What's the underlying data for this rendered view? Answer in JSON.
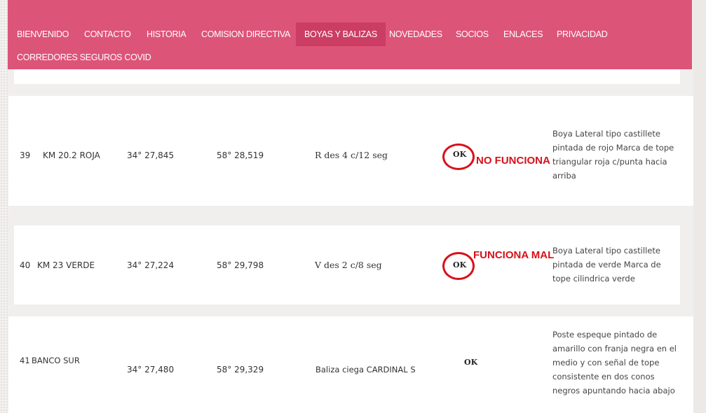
{
  "nav": {
    "items": [
      {
        "label": "BIENVENIDO"
      },
      {
        "label": "CONTACTO"
      },
      {
        "label": "HISTORIA"
      },
      {
        "label": "COMISION DIRECTIVA"
      },
      {
        "label": "BOYAS Y BALIZAS",
        "active": true
      },
      {
        "label": "NOVEDADES"
      },
      {
        "label": "SOCIOS"
      },
      {
        "label": "ENLACES"
      },
      {
        "label": "PRIVACIDAD"
      },
      {
        "label": "CORREDORES SEGUROS COVID"
      }
    ]
  },
  "rows": [
    {
      "num": "39",
      "name": "KM 20.2 ROJA",
      "lat": "34° 27,845",
      "lon": "58° 28,519",
      "light": "R des 4 c/12 seg",
      "status": "OK",
      "annotation": "NO FUNCIONA",
      "description": "Boya Lateral tipo castillete pintada de rojo Marca de tope triangular roja c/punta hacia arriba"
    },
    {
      "num": "40",
      "name": "KM 23 VERDE",
      "lat": "34° 27,224",
      "lon": "58° 29,798",
      "light": "V des 2 c/8 seg",
      "status": "OK",
      "annotation": "FUNCIONA MAL",
      "description": "Boya Lateral tipo castillete pintada de verde Marca de tope cilindrica verde"
    },
    {
      "num": "41",
      "name": "BANCO SUR",
      "lat": "34° 27,480",
      "lon": "58° 29,329",
      "light": "Baliza ciega CARDINAL S",
      "status": "OK",
      "description": "Poste espeque pintado de amarillo con franja negra en el medio y con señal de tope consistente en dos conos negros apuntando hacia abajo"
    }
  ],
  "colors": {
    "nav": "#dd5479",
    "nav_active": "#cb3d63",
    "annotation": "#d8101a"
  }
}
